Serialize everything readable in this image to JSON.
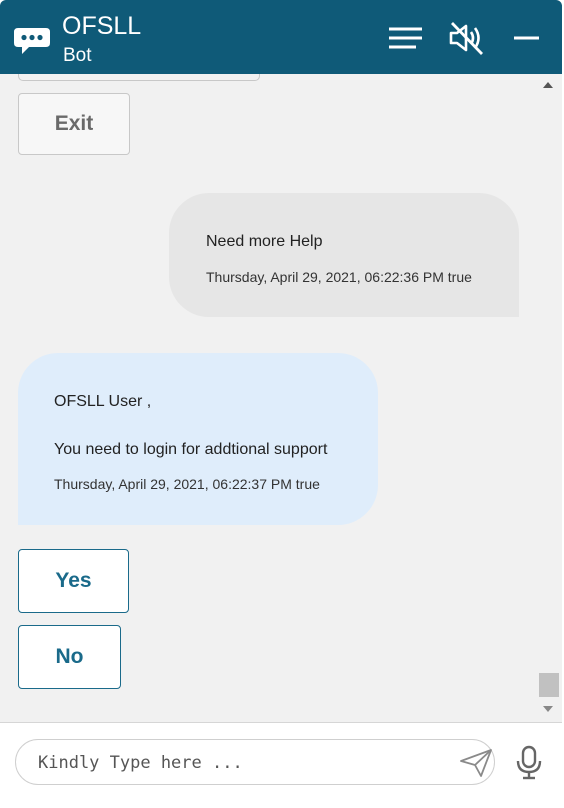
{
  "header": {
    "title": "OFSLL",
    "subtitle": "Bot",
    "accent_color": "#0f5a78",
    "icons": [
      "chat-bubble-icon",
      "menu-icon",
      "speaker-muted-icon",
      "minimize-icon"
    ]
  },
  "conversation": {
    "exit_label": "Exit",
    "user_message": {
      "text": "Need more Help",
      "timestamp": "Thursday, April 29, 2021, 06:22:36 PM true"
    },
    "bot_message": {
      "line1": "OFSLL User ,",
      "line2": "You need to login for addtional support",
      "timestamp": "Thursday, April 29, 2021, 06:22:37 PM true"
    },
    "options": [
      "Yes",
      "No"
    ]
  },
  "footer": {
    "input_placeholder": "Kindly Type here ...",
    "icons": [
      "send-icon",
      "microphone-icon"
    ]
  }
}
